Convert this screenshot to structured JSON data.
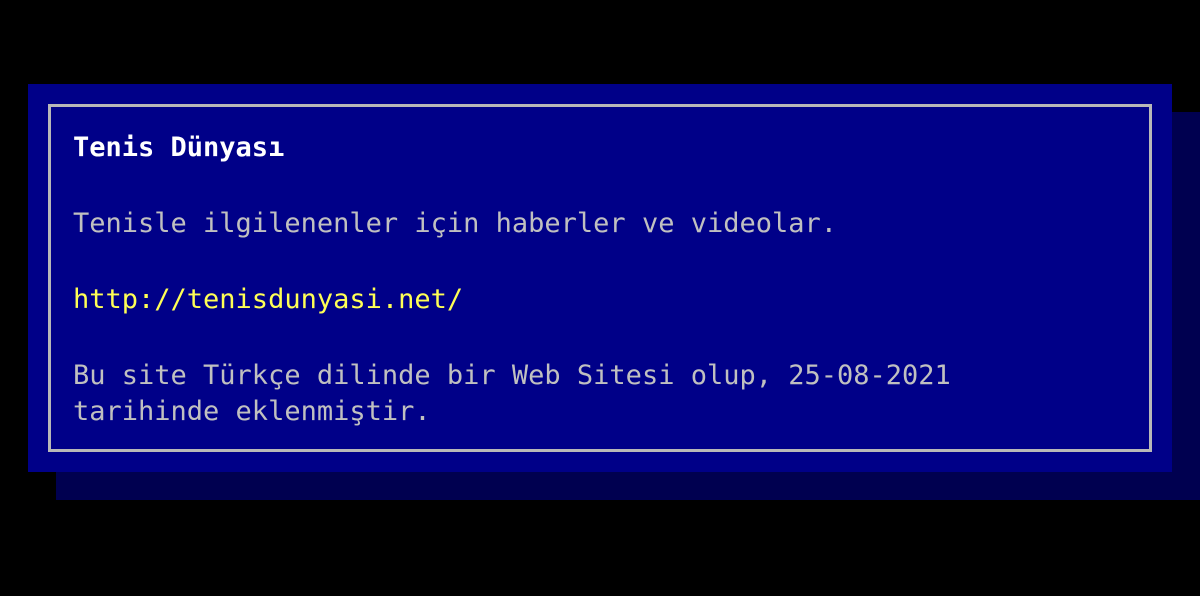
{
  "site": {
    "title": "Tenis Dünyası",
    "description": "Tenisle ilgilenenler için haberler ve videolar.",
    "url": "http://tenisdunyasi.net/",
    "info_line1": "Bu site Türkçe dilinde bir Web Sitesi olup, 25-08-2021",
    "info_line2": "tarihinde eklenmiştir."
  },
  "colors": {
    "background": "#000000",
    "panel": "#000088",
    "shadow": "#000050",
    "border": "#b8b8b8",
    "title": "#ffffff",
    "text": "#c0c0c0",
    "link": "#ffff55"
  }
}
